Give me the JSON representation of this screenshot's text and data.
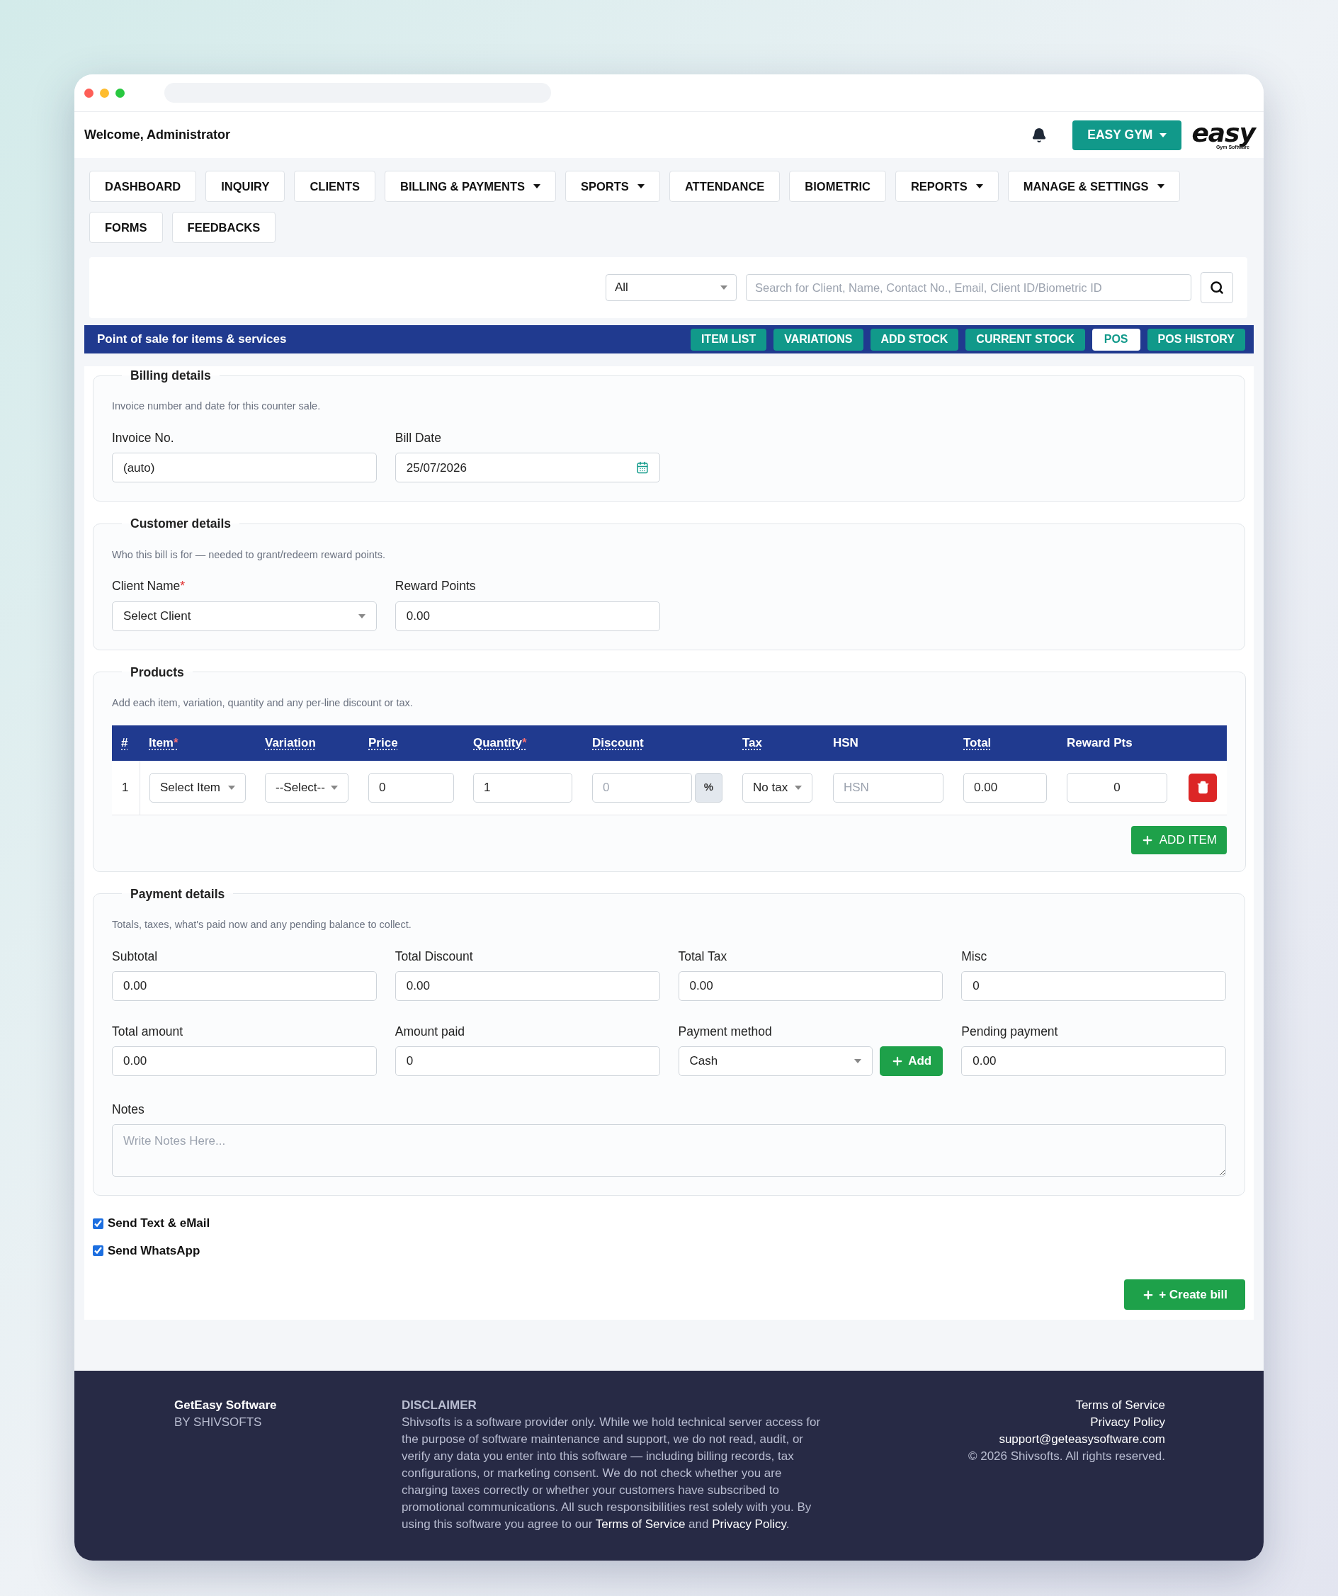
{
  "header": {
    "welcome": "Welcome, Administrator",
    "gym_menu": "EASY GYM",
    "logo": {
      "word": "easy",
      "tagline": "Gym Software"
    }
  },
  "nav": [
    {
      "label": "DASHBOARD",
      "dropdown": false
    },
    {
      "label": "INQUIRY",
      "dropdown": false
    },
    {
      "label": "CLIENTS",
      "dropdown": false
    },
    {
      "label": "BILLING & PAYMENTS",
      "dropdown": true
    },
    {
      "label": "SPORTS",
      "dropdown": true
    },
    {
      "label": "ATTENDANCE",
      "dropdown": false
    },
    {
      "label": "BIOMETRIC",
      "dropdown": false
    },
    {
      "label": "REPORTS",
      "dropdown": true
    },
    {
      "label": "MANAGE & SETTINGS",
      "dropdown": true
    },
    {
      "label": "FORMS",
      "dropdown": false
    },
    {
      "label": "FEEDBACKS",
      "dropdown": false
    }
  ],
  "search": {
    "filter": "All",
    "placeholder": "Search for Client, Name, Contact No., Email, Client ID/Biometric ID"
  },
  "module_bar": {
    "title": "Point of sale for items & services",
    "tabs": [
      {
        "label": "ITEM LIST",
        "selected": false
      },
      {
        "label": "VARIATIONS",
        "selected": false
      },
      {
        "label": "ADD STOCK",
        "selected": false
      },
      {
        "label": "CURRENT STOCK",
        "selected": false
      },
      {
        "label": "POS",
        "selected": true
      },
      {
        "label": "POS HISTORY",
        "selected": false
      }
    ]
  },
  "billing": {
    "legend": "Billing details",
    "hint": "Invoice number and date for this counter sale.",
    "fields": [
      {
        "label": "Invoice No.",
        "value": "(auto)",
        "kind": "text"
      },
      {
        "label": "Bill Date",
        "value": "25/07/2026",
        "kind": "date"
      }
    ]
  },
  "customer": {
    "legend": "Customer details",
    "hint": "Who this bill is for — needed to grant/redeem reward points.",
    "fields": [
      {
        "label": "Client Name",
        "value": "Select Client",
        "kind": "select",
        "required_mark": "*"
      },
      {
        "label": "Reward Points",
        "value": "0.00",
        "kind": "text"
      }
    ]
  },
  "products": {
    "legend": "Products",
    "hint": "Add each item, variation, quantity and any per-line discount or tax.",
    "columns": [
      {
        "label": "#",
        "tooltip": true
      },
      {
        "label": "Item",
        "required_mark": "*",
        "tooltip": true
      },
      {
        "label": "Variation",
        "tooltip": true
      },
      {
        "label": "Price",
        "tooltip": true
      },
      {
        "label": "Quantity",
        "required_mark": "*",
        "tooltip": true
      },
      {
        "label": "Discount",
        "tooltip": true
      },
      {
        "label": "Tax",
        "tooltip": true
      },
      {
        "label": "HSN",
        "tooltip": false
      },
      {
        "label": "Total",
        "tooltip": true
      },
      {
        "label": "Reward Pts",
        "tooltip": false
      }
    ],
    "rows": [
      {
        "number": "1",
        "item": "Select Item",
        "variation": "--Select--",
        "price": "0",
        "quantity": "1",
        "discount_placeholder": "0",
        "discount_unit": "%",
        "tax": "No tax",
        "hsn_placeholder": "HSN",
        "total": "0.00",
        "reward_pts": "0"
      }
    ],
    "add_button": "ADD ITEM"
  },
  "payment": {
    "legend": "Payment details",
    "hint": "Totals, taxes, what's paid now and any pending balance to collect.",
    "fields": [
      {
        "label": "Subtotal",
        "value": "0.00",
        "kind": "text"
      },
      {
        "label": "Total Discount",
        "value": "0.00",
        "kind": "text"
      },
      {
        "label": "Total Tax",
        "value": "0.00",
        "kind": "text"
      },
      {
        "label": "Misc",
        "value": "0",
        "kind": "text"
      },
      {
        "label": "Total amount",
        "value": "0.00",
        "kind": "text"
      },
      {
        "label": "Amount paid",
        "value": "0",
        "kind": "text"
      },
      {
        "label": "Payment method",
        "value": "Cash",
        "kind": "select_add",
        "button": "Add"
      },
      {
        "label": "Pending payment",
        "value": "0.00",
        "kind": "text"
      }
    ],
    "notes": {
      "label": "Notes",
      "placeholder": "Write Notes Here..."
    }
  },
  "notifications": [
    {
      "label": "Send Text & eMail",
      "checked": true
    },
    {
      "label": "Send WhatsApp",
      "checked": true
    }
  ],
  "create_button": "+ Create bill",
  "footer": {
    "brand": "GetEasy Software",
    "by": "BY SHIVSOFTS",
    "disclaimer_title": "DISCLAIMER",
    "disclaimer": {
      "text": "Shivsofts is a software provider only. While we hold technical server access for the purpose of software maintenance and support, we do not read, audit, or verify any data you enter into this software — including billing records, tax configurations, or marketing consent. We do not check whether you are charging taxes correctly or whether your customers have subscribed to promotional communications. All such responsibilities rest solely with you. By using this software you agree to our ",
      "links": [
        "Terms of Service",
        "Privacy Policy"
      ],
      "joiner": " and ",
      "end": "."
    },
    "links": [
      "Terms of Service",
      "Privacy Policy",
      "support@geteasysoftware.com"
    ],
    "copyright": "© 2026 Shivsofts. All rights reserved."
  }
}
